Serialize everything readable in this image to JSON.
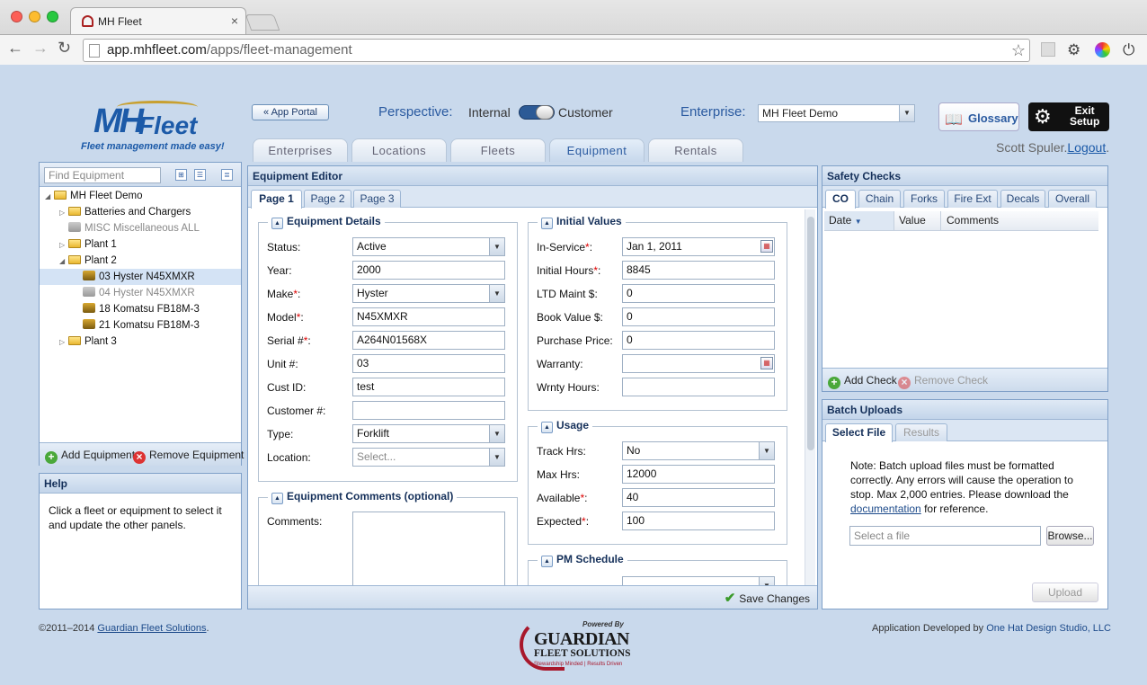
{
  "browser": {
    "tab_title": "MH Fleet",
    "url_domain": "app.mhfleet.com",
    "url_path": "/apps/fleet-management"
  },
  "header": {
    "logo_mh": "MH",
    "logo_fleet": "Fleet",
    "logo_tagline": "Fleet management made easy!",
    "app_portal_label": "« App Portal",
    "perspective_label": "Perspective:",
    "perspective_internal": "Internal",
    "perspective_customer": "Customer",
    "enterprise_label": "Enterprise:",
    "enterprise_value": "MH Fleet Demo",
    "glossary_label": "Glossary",
    "exit_setup_line1": "Exit",
    "exit_setup_line2": "Setup",
    "user_name": "Scott Spuler.",
    "logout_label": "Logout",
    "logout_suffix": "."
  },
  "main_tabs": [
    "Enterprises",
    "Locations",
    "Fleets",
    "Equipment",
    "Rentals"
  ],
  "left_panel": {
    "search_placeholder": "Find Equipment",
    "tree": [
      {
        "label": "MH Fleet Demo"
      },
      {
        "label": "Batteries and Chargers"
      },
      {
        "label": "MISC Miscellaneous ALL"
      },
      {
        "label": "Plant 1"
      },
      {
        "label": "Plant 2"
      },
      {
        "label": "03 Hyster N45XMXR"
      },
      {
        "label": "04 Hyster N45XMXR"
      },
      {
        "label": "18 Komatsu FB18M-3"
      },
      {
        "label": "21 Komatsu FB18M-3"
      },
      {
        "label": "Plant 3"
      }
    ],
    "add_label": "Add Equipment",
    "remove_label": "Remove Equipment"
  },
  "help": {
    "title": "Help",
    "text": "Click a fleet or equipment to select it and update the other panels."
  },
  "editor": {
    "title": "Equipment Editor",
    "pages": [
      "Page 1",
      "Page 2",
      "Page 3"
    ],
    "details_title": "Equipment Details",
    "details": [
      {
        "label": "Status:",
        "req": "",
        "value": "Active"
      },
      {
        "label": "Year:",
        "req": "",
        "value": "2000"
      },
      {
        "label": "Make",
        "req": "*",
        "suffix": ":",
        "value": "Hyster"
      },
      {
        "label": "Model",
        "req": "*",
        "suffix": ":",
        "value": "N45XMXR"
      },
      {
        "label": "Serial #",
        "req": "*",
        "suffix": ":",
        "value": "A264N01568X"
      },
      {
        "label": "Unit #:",
        "req": "",
        "value": "03"
      },
      {
        "label": "Cust ID:",
        "req": "",
        "value": "test"
      },
      {
        "label": "Customer #:",
        "req": "",
        "value": ""
      },
      {
        "label": "Type:",
        "req": "",
        "value": "Forklift"
      },
      {
        "label": "Location:",
        "req": "",
        "value": "Select..."
      }
    ],
    "comments_title": "Equipment Comments (optional)",
    "comments_label": "Comments:",
    "initial_title": "Initial Values",
    "initial": [
      {
        "label": "In-Service",
        "req": "*",
        "suffix": ":",
        "value": "Jan 1, 2011"
      },
      {
        "label": "Initial Hours",
        "req": "*",
        "suffix": ":",
        "value": "8845"
      },
      {
        "label": "LTD Maint $:",
        "req": "",
        "value": "0"
      },
      {
        "label": "Book Value $:",
        "req": "",
        "value": "0"
      },
      {
        "label": "Purchase Price:",
        "req": "",
        "value": "0"
      },
      {
        "label": "Warranty:",
        "req": "",
        "value": ""
      },
      {
        "label": "Wrnty Hours:",
        "req": "",
        "value": ""
      }
    ],
    "usage_title": "Usage",
    "usage": [
      {
        "label": "Track Hrs:",
        "req": "",
        "value": "No"
      },
      {
        "label": "Max Hrs:",
        "req": "",
        "value": "12000"
      },
      {
        "label": "Available",
        "req": "*",
        "suffix": ":",
        "value": "40"
      },
      {
        "label": "Expected",
        "req": "*",
        "suffix": ":",
        "value": "100"
      }
    ],
    "pm_title": "PM Schedule",
    "save_label": "Save Changes"
  },
  "safety": {
    "title": "Safety Checks",
    "tabs": [
      "CO",
      "Chain",
      "Forks",
      "Fire Ext",
      "Decals",
      "Overall"
    ],
    "columns": [
      "Date",
      "Value",
      "Comments"
    ],
    "add_label": "Add Check",
    "remove_label": "Remove Check"
  },
  "batch": {
    "title": "Batch Uploads",
    "tabs": [
      "Select File",
      "Results"
    ],
    "note_pre": "Note: Batch upload files must be formatted correctly. Any errors will cause the operation to stop. Max 2,000 entries. Please download the ",
    "note_link": "documentation",
    "note_post": " for reference.",
    "file_placeholder": "Select a file",
    "browse_label": "Browse...",
    "upload_label": "Upload"
  },
  "footer": {
    "copyright": "©2011–2014 ",
    "company_link": "Guardian Fleet Solutions",
    "company_suffix": ".",
    "developed_prefix": "Application Developed by ",
    "developer": "One Hat Design Studio, LLC",
    "gfs_powered": "Powered By",
    "gfs_name1": "GUARDIAN",
    "gfs_name2": "FLEET SOLUTIONS",
    "gfs_tag": "Stewardship Minded | Results Driven"
  }
}
